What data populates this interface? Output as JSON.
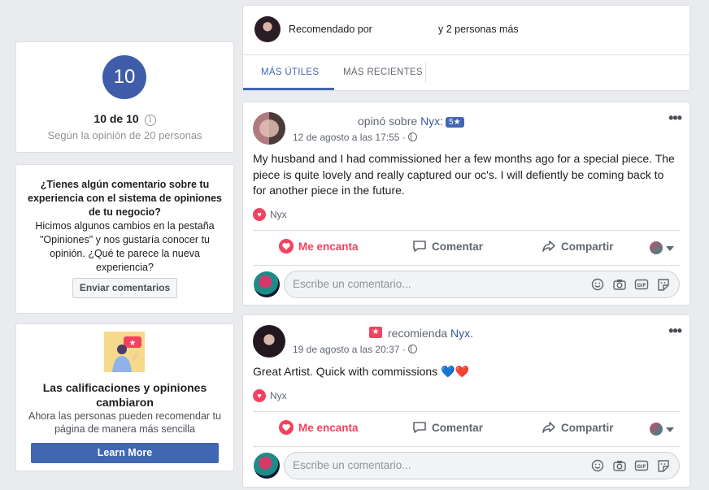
{
  "rating": {
    "score": "10",
    "score_line": "10 de 10",
    "info_glyph": "i",
    "subtitle": "Según la opinión de 20 personas"
  },
  "feedback": {
    "title": "¿Tienes algún comentario sobre tu experiencia con el sistema de opiniones de tu negocio?",
    "body": "Hicimos algunos cambios en la pestaña \"Opiniones\" y nos gustaría conocer tu opinión. ¿Qué te parece la nueva experiencia?",
    "button": "Enviar comentarios"
  },
  "changes": {
    "title": "Las calificaciones y opiniones cambiaron",
    "body": "Ahora las personas pueden recomendar tu página de manera más sencilla",
    "button": "Learn More"
  },
  "header": {
    "recommended_by": "Recomendado por",
    "and_more": "y 2 personas más",
    "tabs": [
      {
        "label": "MÁS ÚTILES",
        "active": true
      },
      {
        "label": "MÁS RECIENTES",
        "active": false
      }
    ]
  },
  "posts": [
    {
      "action": "opinó sobre",
      "page": "Nyx:",
      "stars": "5★",
      "date": "12 de agosto a las 17:55 ·",
      "text": "My husband and I had commissioned her a few months ago for a special piece. The piece is quite lovely and really captured our oc's. I will defiently be coming back to for another piece in the future.",
      "reaction_name": "Nyx"
    },
    {
      "action": "recomienda",
      "page": "Nyx.",
      "date": "19 de agosto a las 20:37 ·",
      "text": "Great Artist. Quick with commissions 💙❤️",
      "reaction_name": "Nyx"
    }
  ],
  "actions": {
    "love": "Me encanta",
    "comment": "Comentar",
    "share": "Compartir",
    "more_glyph": "•••"
  },
  "comment_box": {
    "placeholder": "Escribe un comentario..."
  },
  "colors": {
    "brand": "#4267b2",
    "love": "#f3425f",
    "score_circle": "#3f5da8"
  }
}
